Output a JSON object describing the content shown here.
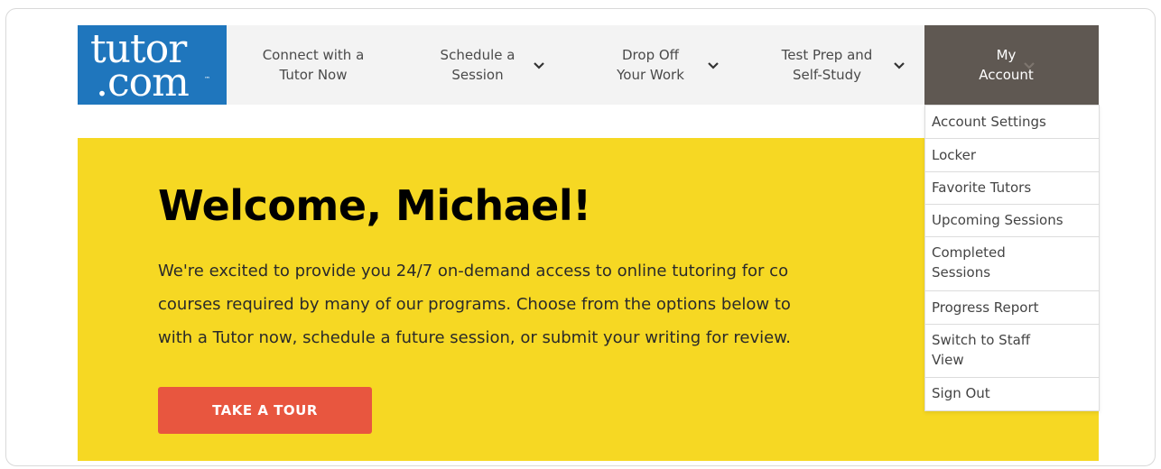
{
  "logo": {
    "line1": "tutor",
    "line2": ".com",
    "tm": "™"
  },
  "nav": {
    "items": [
      {
        "label": "Connect with a\nTutor Now"
      },
      {
        "label": "Schedule a\nSession"
      },
      {
        "label": "Drop Off\nYour Work"
      },
      {
        "label": "Test Prep and\nSelf-Study"
      }
    ],
    "account": "My\nAccount"
  },
  "banner": {
    "title": "Welcome, Michael!",
    "lines": [
      "We're excited to provide you 24/7 on-demand access to online tutoring for co",
      "courses required by many of our programs. Choose from the options below to",
      "with a Tutor now, schedule a future session, or submit your writing for review."
    ],
    "tour_button": "TAKE A TOUR"
  },
  "dropdown": {
    "items": [
      "Account Settings",
      "Locker",
      "Favorite Tutors",
      "Upcoming Sessions",
      "Completed\nSessions",
      "Progress Report",
      "Switch to Staff\nView",
      "Sign Out"
    ]
  },
  "colors": {
    "brand_blue": "#1f76bd",
    "account_bg": "#5f5852",
    "banner": "#f6d823",
    "tour": "#e8563f"
  }
}
